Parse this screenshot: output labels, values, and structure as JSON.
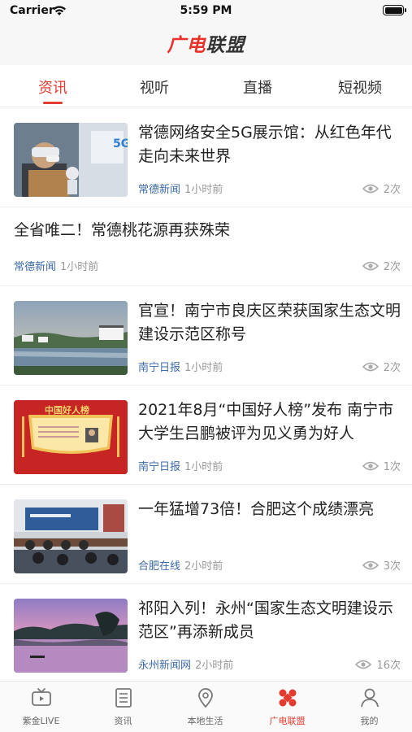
{
  "status_bar": {
    "carrier": "Carrier",
    "time": "5:59 PM"
  },
  "header": {
    "logo_part1": "广电",
    "logo_part2": "联盟"
  },
  "tabs": [
    {
      "label": "资讯",
      "active": true
    },
    {
      "label": "视听",
      "active": false
    },
    {
      "label": "直播",
      "active": false
    },
    {
      "label": "短视频",
      "active": false
    }
  ],
  "news": [
    {
      "title": "常德网络安全5G展示馆：从红色年代走向未来世界",
      "source": "常德新闻",
      "time": "1小时前",
      "views": "2次",
      "thumb": "5g-exhibition-photo"
    },
    {
      "title": "全省唯二！常德桃花源再获殊荣",
      "source": "常德新闻",
      "time": "1小时前",
      "views": "2次",
      "thumb": null
    },
    {
      "title": "官宣！南宁市良庆区荣获国家生态文明建设示范区称号",
      "source": "南宁日报",
      "time": "1小时前",
      "views": "2次",
      "thumb": "lake-village-photo"
    },
    {
      "title": "2021年8月“中国好人榜”发布 南宁市大学生吕鹏被评为见义勇为好人",
      "source": "南宁日报",
      "time": "1小时前",
      "views": "1次",
      "thumb": "good-person-poster"
    },
    {
      "title": "一年猛增73倍！合肥这个成绩漂亮",
      "source": "合肥在线",
      "time": "2小时前",
      "views": "3次",
      "thumb": "press-conference-photo"
    },
    {
      "title": "祁阳入列！永州“国家生态文明建设示范区”再添新成员",
      "source": "永州新闻网",
      "time": "2小时前",
      "views": "16次",
      "thumb": "sunset-lake-photo"
    }
  ],
  "thumb_poster_text": "中国好人榜",
  "tab_bar": [
    {
      "label": "紫金LIVE",
      "icon": "tv-icon",
      "active": false
    },
    {
      "label": "资讯",
      "icon": "news-icon",
      "active": false
    },
    {
      "label": "本地生活",
      "icon": "location-icon",
      "active": false
    },
    {
      "label": "广电联盟",
      "icon": "alliance-icon",
      "active": true
    },
    {
      "label": "我的",
      "icon": "user-icon",
      "active": false
    }
  ],
  "colors": {
    "accent": "#e23b2f",
    "source_blue": "#3d6aa8",
    "meta_gray": "#999999"
  }
}
